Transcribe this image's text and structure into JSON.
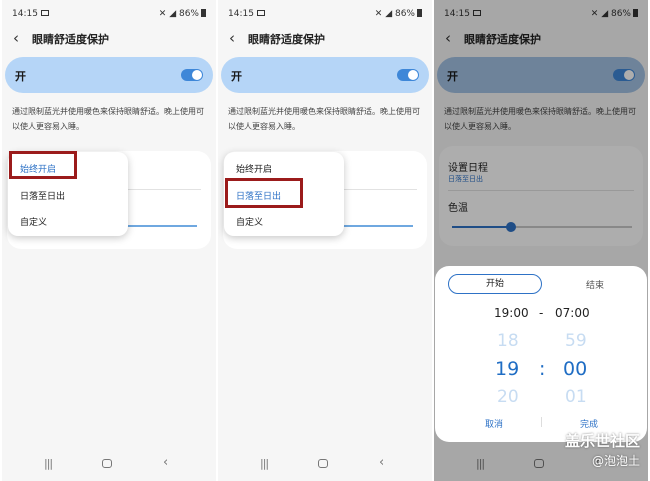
{
  "status": {
    "time": "14:15",
    "battery": "86%"
  },
  "header": {
    "title": "眼睛舒适度保护"
  },
  "toggle": {
    "label": "开"
  },
  "description": "通过限制蓝光并使用暖色来保持眼睛舒适。晚上使用可以使人更容易入睡。",
  "menu": {
    "items": [
      "始终开启",
      "日落至日出",
      "自定义"
    ]
  },
  "schedule": {
    "title": "设置日程",
    "value": "日落至日出",
    "color_temp_label": "色温",
    "color_temp_level": 0.33
  },
  "picker": {
    "tab_start": "开始",
    "tab_end": "结束",
    "range_start": "19:00",
    "range_sep": "-",
    "range_end": "07:00",
    "hour_prev": "18",
    "hour_cur": "19",
    "hour_next": "20",
    "min_prev": "59",
    "min_cur": "00",
    "min_next": "01",
    "colon": ":",
    "cancel": "取消",
    "done": "完成"
  },
  "watermark": {
    "line1": "盖乐世社区",
    "line2": "@泡泡土"
  },
  "colors": {
    "accent": "#2e72c6",
    "toggle_bg": "#b5d5f7",
    "highlight_border": "#9b1b1b"
  },
  "icons": {
    "back": "back-arrow-icon",
    "nav_recent": "recent-apps-icon",
    "nav_home": "home-icon",
    "nav_back": "nav-back-icon"
  }
}
